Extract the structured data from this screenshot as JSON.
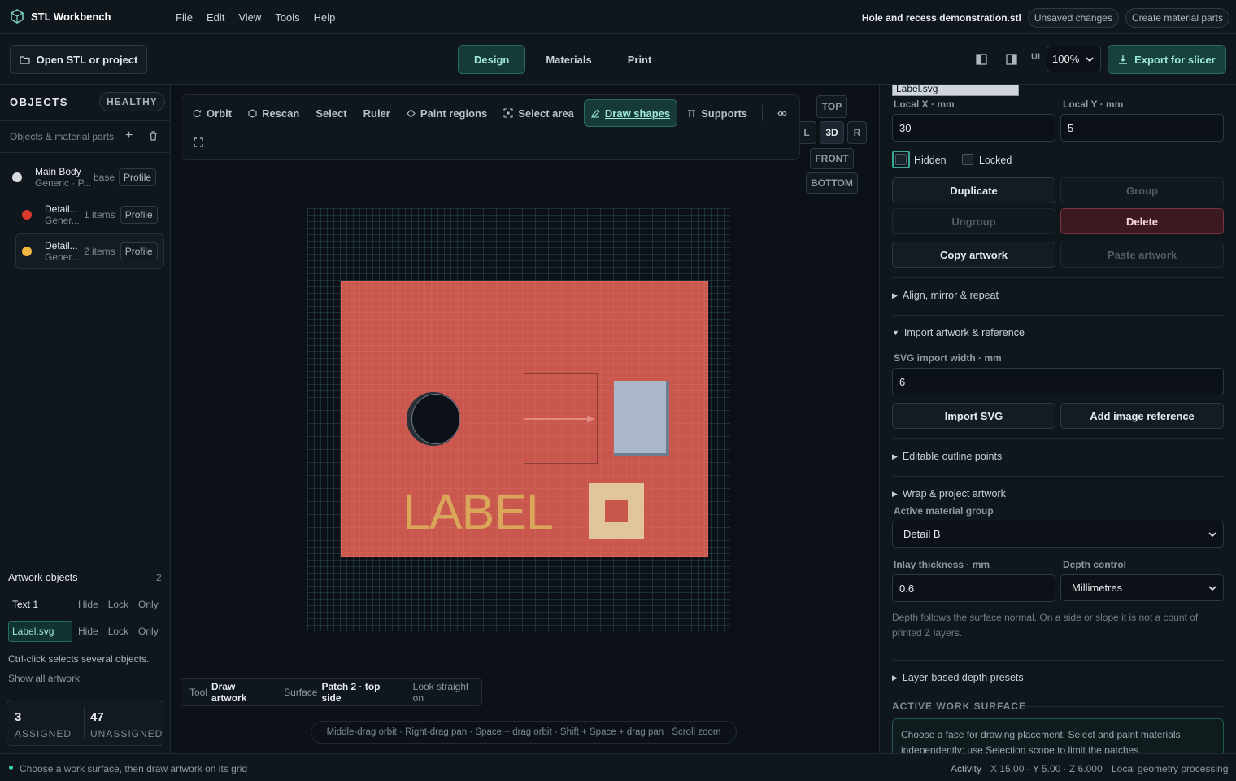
{
  "app": {
    "title": "STL Workbench",
    "menu": [
      "File",
      "Edit",
      "View",
      "Tools",
      "Help"
    ],
    "filename": "Hole and recess demonstration.stl",
    "unsaved": "Unsaved changes",
    "create_parts": "Create material parts"
  },
  "toolbar": {
    "open": "Open STL or project",
    "modes": [
      "Design",
      "Materials",
      "Print"
    ],
    "active_mode": "Design",
    "ui_label": "UI",
    "zoom": "100%",
    "export": "Export for slicer"
  },
  "objects": {
    "title": "OBJECTS",
    "health": "HEALTHY",
    "subtitle": "Objects & material parts",
    "items": [
      {
        "name": "Main Body",
        "sub": "Generic · P...",
        "count": "base",
        "profile": "Profile",
        "color": "#d6d9dd"
      },
      {
        "name": "Detail...",
        "sub": "Gener...",
        "count": "1 items",
        "profile": "Profile",
        "color": "#d83a2c"
      },
      {
        "name": "Detail...",
        "sub": "Gener...",
        "count": "2 items",
        "profile": "Profile",
        "color": "#f0b840"
      }
    ]
  },
  "artwork": {
    "title": "Artwork objects",
    "count": "2",
    "items": [
      {
        "name": "Text 1",
        "hide": "Hide",
        "lock": "Lock",
        "only": "Only"
      },
      {
        "name": "Label.svg",
        "hide": "Hide",
        "lock": "Lock",
        "only": "Only"
      }
    ],
    "hint": "Ctrl-click selects several objects.",
    "show_all": "Show all artwork",
    "assigned": "3",
    "assigned_label": "ASSIGNED",
    "unassigned": "47",
    "unassigned_label": "UNASSIGNED"
  },
  "viewport": {
    "tools": [
      "Orbit",
      "Rescan",
      "Select",
      "Ruler",
      "Paint regions",
      "Select area",
      "Draw shapes",
      "Supports"
    ],
    "active_tool": "Draw shapes",
    "views": {
      "top": "TOP",
      "l": "L",
      "d3": "3D",
      "r": "R",
      "front": "FRONT",
      "bottom": "BOTTOM"
    },
    "label_text": "LABEL",
    "info": {
      "tool_label": "Tool",
      "tool": "Draw artwork",
      "surface_label": "Surface",
      "surface": "Patch 2 · top side",
      "look": "Look straight on"
    },
    "hint": "Middle-drag orbit · Right-drag pan · Space + drag orbit · Shift + Space + drag pan · Scroll zoom"
  },
  "panel": {
    "name_value": "Label.svg",
    "local_x_label": "Local X · mm",
    "local_x": "30",
    "local_y_label": "Local Y · mm",
    "local_y": "5",
    "hidden": "Hidden",
    "locked": "Locked",
    "duplicate": "Duplicate",
    "group": "Group",
    "ungroup": "Ungroup",
    "delete": "Delete",
    "copy_art": "Copy artwork",
    "paste_art": "Paste artwork",
    "align": "Align, mirror & repeat",
    "import_ref": "Import artwork & reference",
    "svg_width_label": "SVG import width · mm",
    "svg_width": "6",
    "import_svg": "Import SVG",
    "add_image": "Add image reference",
    "outline": "Editable outline points",
    "wrap": "Wrap & project artwork",
    "active_group_label": "Active material group",
    "active_group": "Detail B",
    "inlay_label": "Inlay thickness · mm",
    "inlay": "0.6",
    "depth_label": "Depth control",
    "depth": "Millimetres",
    "depth_note": "Depth follows the surface normal. On a side or slope it is not a count of printed Z layers.",
    "presets": "Layer-based depth presets",
    "surface_title": "ACTIVE WORK SURFACE",
    "surface_note": "Choose a face for drawing placement. Select and paint materials independently: use Selection scope to limit the patches."
  },
  "status": {
    "left": "Choose a work surface, then draw artwork on its grid",
    "activity": "Activity",
    "coords": "X 15.00 · Y 5.00 · Z 6.000",
    "local": "Local geometry processing"
  },
  "colors": {
    "accent": "#2a6b61",
    "plate": "#c9574e",
    "label": "#d9a65a",
    "danger": "#7a3540"
  }
}
